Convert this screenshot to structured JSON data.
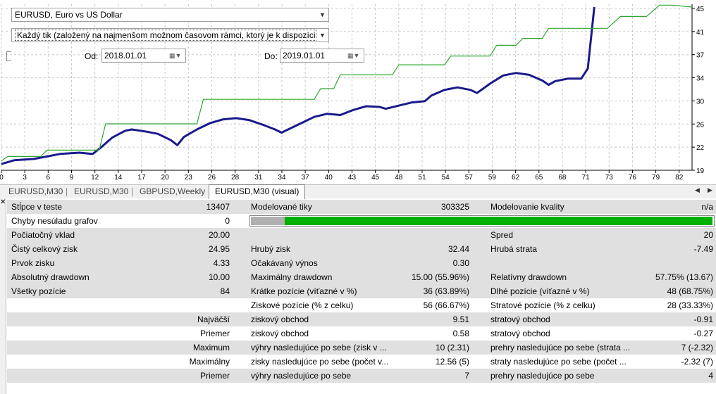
{
  "controls": {
    "symbol_select": "EURUSD, Euro vs US Dollar",
    "model_select": "Každý tik (založený na najmenšom možnom časovom rámci, ktorý je k dispozícii s fraktálno",
    "from_label": "Od:",
    "from_value": "2018.01.01",
    "to_label": "Do:",
    "to_value": "2019.01.01"
  },
  "chart_data": {
    "type": "line",
    "x_ticks": [
      "0",
      "3",
      "6",
      "9",
      "12",
      "14",
      "17",
      "20",
      "23",
      "26",
      "28",
      "31",
      "34",
      "37",
      "40",
      "43",
      "45",
      "48",
      "51",
      "54",
      "57",
      "59",
      "62",
      "65",
      "68",
      "71",
      "73",
      "76",
      "79",
      "82"
    ],
    "y_ticks": [
      "45",
      "41",
      "37",
      "34",
      "30",
      "26",
      "22",
      "19"
    ],
    "ylim": [
      19,
      45
    ],
    "xlim": [
      0,
      84
    ],
    "series": [
      {
        "color": "#1a1a8c",
        "points": [
          [
            0,
            20
          ],
          [
            2,
            20.6
          ],
          [
            5,
            20.8
          ],
          [
            7,
            21.2
          ],
          [
            9,
            21.6
          ],
          [
            12,
            21.8
          ],
          [
            14,
            21.6
          ],
          [
            15,
            22.4
          ],
          [
            17,
            24.2
          ],
          [
            19,
            25.3
          ],
          [
            20,
            25.5
          ],
          [
            22,
            25.2
          ],
          [
            24,
            24.8
          ],
          [
            26,
            23.8
          ],
          [
            27,
            23
          ],
          [
            28,
            24.3
          ],
          [
            30,
            25.5
          ],
          [
            32,
            26.5
          ],
          [
            34,
            27.1
          ],
          [
            36,
            27.3
          ],
          [
            38,
            27
          ],
          [
            40,
            26.3
          ],
          [
            42,
            25.5
          ],
          [
            43,
            25
          ],
          [
            44,
            25.5
          ],
          [
            46,
            26.5
          ],
          [
            48,
            27.5
          ],
          [
            50,
            28
          ],
          [
            52,
            27.8
          ],
          [
            54,
            28.6
          ],
          [
            56,
            29.2
          ],
          [
            58,
            29.1
          ],
          [
            59,
            28.8
          ],
          [
            61,
            29.3
          ],
          [
            63,
            29.8
          ],
          [
            65,
            30
          ],
          [
            66,
            30.9
          ],
          [
            68,
            31.8
          ],
          [
            70,
            32.2
          ],
          [
            72,
            31.8
          ],
          [
            73,
            31.3
          ],
          [
            75,
            32.8
          ],
          [
            77,
            34.1
          ],
          [
            79,
            34.5
          ],
          [
            81,
            34.2
          ],
          [
            83,
            33.3
          ],
          [
            84,
            32.6
          ],
          [
            85,
            33.2
          ],
          [
            87,
            33.6
          ],
          [
            89,
            33.6
          ],
          [
            90,
            35.2
          ],
          [
            91,
            45
          ]
        ]
      },
      {
        "color": "#2ea82e",
        "points": [
          [
            0,
            20.5
          ],
          [
            1,
            21.2
          ],
          [
            6,
            21.2
          ],
          [
            7,
            22.2
          ],
          [
            15,
            22.2
          ],
          [
            16,
            26.4
          ],
          [
            30,
            26.4
          ],
          [
            31,
            30.3
          ],
          [
            48,
            30.3
          ],
          [
            49,
            32
          ],
          [
            51,
            32
          ],
          [
            52,
            34.2
          ],
          [
            60,
            34.2
          ],
          [
            61,
            35.8
          ],
          [
            68,
            35.8
          ],
          [
            69,
            37.2
          ],
          [
            75,
            37.2
          ],
          [
            76,
            38.9
          ],
          [
            79,
            38.9
          ],
          [
            80,
            40
          ],
          [
            83,
            40
          ],
          [
            84,
            41.6
          ],
          [
            93,
            41.6
          ],
          [
            95,
            43.5
          ],
          [
            97,
            43.5
          ],
          [
            99,
            43.5
          ],
          [
            101,
            45.3
          ],
          [
            103,
            45.3
          ],
          [
            106,
            45
          ]
        ]
      }
    ]
  },
  "tabs": [
    "EURUSD,M30",
    "EURUSD,M30",
    "GBPUSD,Weekly",
    "EURUSD,M30 (visual)"
  ],
  "report": {
    "r1": [
      "Stĺpce v teste",
      "13407",
      "Modelované tiky",
      "303325",
      "Modelovanie kvality",
      "n/a"
    ],
    "r2": [
      "Chyby nesúladu grafov",
      "0"
    ],
    "quality_fraction": 0.92,
    "r3": [
      "Počiatočný vklad",
      "20.00",
      "Spred",
      "20"
    ],
    "r4": [
      "Čistý celkový zisk",
      "24.95",
      "Hrubý zisk",
      "32.44",
      "Hrubá strata",
      "-7.49"
    ],
    "r5": [
      "Prvok zisku",
      "4.33",
      "Očakávaný výnos",
      "0.30"
    ],
    "r6": [
      "Absolutný drawdown",
      "10.00",
      "Maximálny drawdown",
      "15.00 (55.96%)",
      "Relatívny drawdown",
      "57.75% (13.67)"
    ],
    "r7": [
      "Všetky pozície",
      "84",
      "Krátke pozície (víťazné v %)",
      "36 (63.89%)",
      "Dlhé pozície (víťazné v %)",
      "48 (68.75%)"
    ],
    "r8": [
      "Ziskové pozície (% z celku)",
      "56 (66.67%)",
      "Stratové pozície (% z celku)",
      "28 (33.33%)"
    ],
    "r9": [
      "Najväčší",
      "ziskový obchod",
      "9.51",
      "stratový obchod",
      "-0.91"
    ],
    "r10": [
      "Priemer",
      "ziskový obchod",
      "0.58",
      "stratový obchod",
      "-0.27"
    ],
    "r11": [
      "Maximum",
      "výhry nasledujúce po sebe (zisk v ...",
      "10 (2.31)",
      "prehry nasledujúce po sebe (strata ...",
      "7 (-2.32)"
    ],
    "r12": [
      "Maximálny",
      "zisky nasledujúce po sebe (počet v...",
      "12.56 (5)",
      "straty nasledujúce po sebe (počet ...",
      "-2.32 (7)"
    ],
    "r13": [
      "Priemer",
      "výhry nasledujúce po sebe",
      "7",
      "prehry nasledujúce po sebe",
      "4"
    ]
  }
}
